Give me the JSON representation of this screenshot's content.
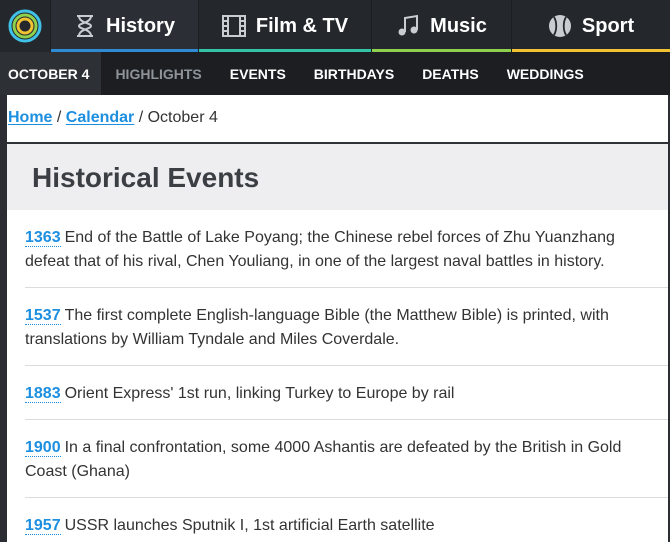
{
  "topnav": {
    "tabs": [
      {
        "label": "History",
        "icon": "hourglass-icon",
        "accent": "#2f8bd3"
      },
      {
        "label": "Film & TV",
        "icon": "film-icon",
        "accent": "#33c4a8"
      },
      {
        "label": "Music",
        "icon": "music-note-icon",
        "accent": "#8fd14f"
      },
      {
        "label": "Sport",
        "icon": "baseball-icon",
        "accent": "#f1c232"
      }
    ]
  },
  "subnav": {
    "date": "OCTOBER 4",
    "items": [
      "HIGHLIGHTS",
      "EVENTS",
      "BIRTHDAYS",
      "DEATHS",
      "WEDDINGS"
    ]
  },
  "breadcrumb": {
    "home": "Home",
    "sep1": " / ",
    "calendar": "Calendar",
    "sep2": " / ",
    "current": "October 4"
  },
  "page_title": "Historical Events",
  "events": [
    {
      "year": "1363",
      "text": "End of the Battle of Lake Poyang; the Chinese rebel forces of Zhu Yuanzhang defeat that of his rival, Chen Youliang, in one of the largest naval battles in history."
    },
    {
      "year": "1537",
      "text": "The first complete English-language Bible (the Matthew Bible) is printed, with translations by William Tyndale and Miles Coverdale."
    },
    {
      "year": "1883",
      "text": "Orient Express' 1st run, linking Turkey to Europe by rail"
    },
    {
      "year": "1900",
      "text": "In a final confrontation, some 4000 Ashantis are defeated by the British in Gold Coast (Ghana)"
    },
    {
      "year": "1957",
      "text": "USSR launches Sputnik I, 1st artificial Earth satellite"
    }
  ]
}
